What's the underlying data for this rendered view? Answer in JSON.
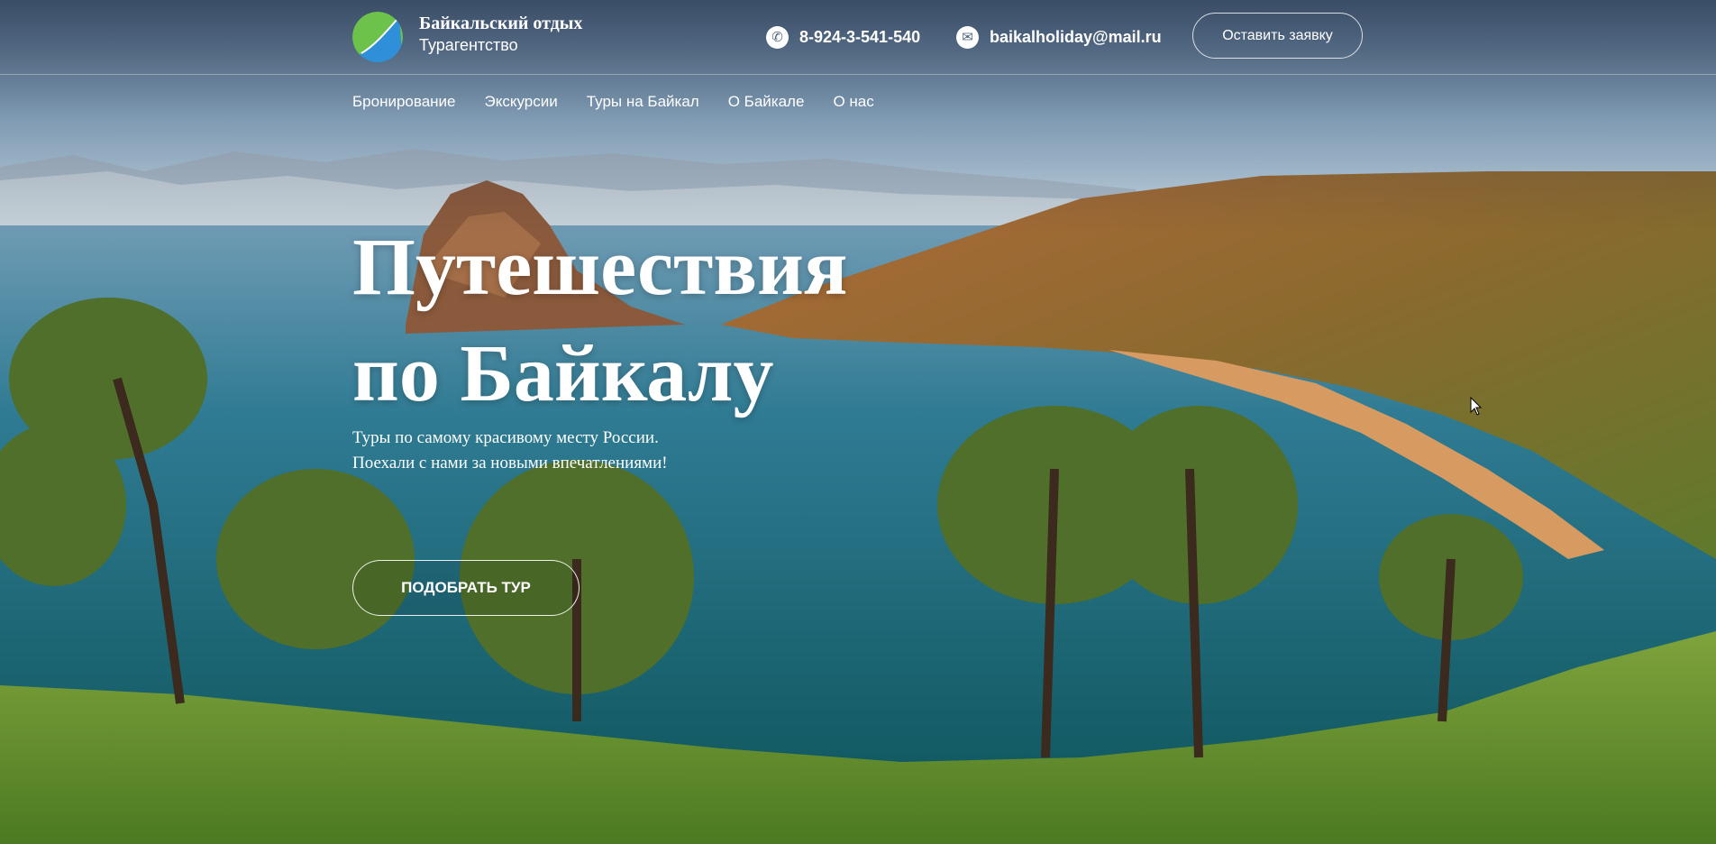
{
  "header": {
    "brand_name": "Байкальский отдых",
    "brand_sub": "Турагентство",
    "phone": "8-924-3-541-540",
    "email": "baikalholiday@mail.ru",
    "cta_label": "Оставить заявку"
  },
  "nav": {
    "items": [
      "Бронирование",
      "Экскурсии",
      "Туры на Байкал",
      "О Байкале",
      "О нас"
    ]
  },
  "hero": {
    "title_line1": "Путешествия",
    "title_line2": "по Байкалу",
    "subtitle_line1": "Туры по самому красивому месту России.",
    "subtitle_line2": "Поехали с нами за новыми впечатлениями!",
    "cta_label": "ПОДОБРАТЬ ТУР"
  },
  "icons": {
    "logo": "logo-icon",
    "phone": "phone-icon",
    "email": "mail-icon"
  },
  "colors": {
    "sky": "#8fb3cf",
    "lake": "#1f6f86",
    "grass": "#6e9a35",
    "cliff": "#a0623a"
  }
}
